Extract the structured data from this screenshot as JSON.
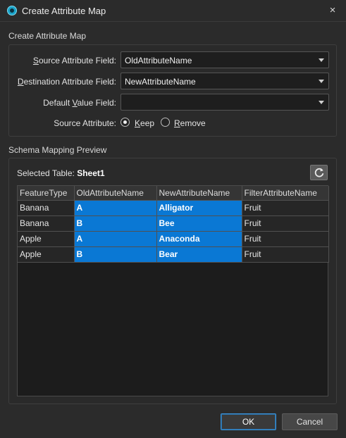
{
  "window": {
    "title": "Create Attribute Map",
    "close_icon": "×"
  },
  "attribute_map": {
    "group_title": "Create Attribute Map",
    "source_field": {
      "label_access": "S",
      "label_rest": "ource Attribute Field:",
      "value": "OldAttributeName"
    },
    "destination_field": {
      "label_access": "D",
      "label_rest": "estination Attribute Field:",
      "value": "NewAttributeName"
    },
    "default_value_field": {
      "label_pre": "Default ",
      "label_access": "V",
      "label_rest": "alue Field:",
      "value": ""
    },
    "source_attribute": {
      "label": "Source Attribute:",
      "options": [
        {
          "access": "K",
          "rest": "eep",
          "checked": true
        },
        {
          "access": "R",
          "rest": "emove",
          "checked": false
        }
      ]
    }
  },
  "schema_preview": {
    "group_title": "Schema Mapping Preview",
    "selected_table_label": "Selected Table:",
    "selected_table_value": "Sheet1",
    "refresh_icon": "refresh-icon",
    "columns": [
      "FeatureType",
      "OldAttributeName",
      "NewAttributeName",
      "FilterAttributeName"
    ],
    "rows": [
      [
        "Banana",
        "A",
        "Alligator",
        "Fruit"
      ],
      [
        "Banana",
        "B",
        "Bee",
        "Fruit"
      ],
      [
        "Apple",
        "A",
        "Anaconda",
        "Fruit"
      ],
      [
        "Apple",
        "B",
        "Bear",
        "Fruit"
      ]
    ]
  },
  "buttons": {
    "ok": "OK",
    "cancel": "Cancel"
  },
  "colors": {
    "selection": "#0a78d4",
    "ok_border": "#3b8fd1",
    "background": "#2b2b2b"
  }
}
